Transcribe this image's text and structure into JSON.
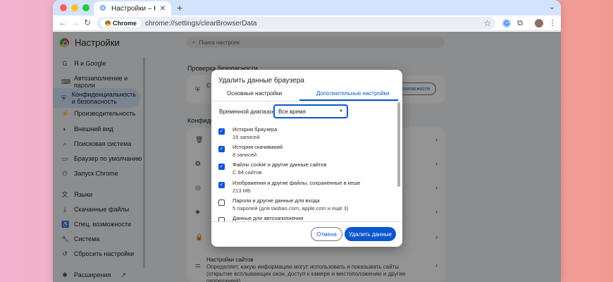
{
  "browser": {
    "tab_title": "Настройки – Конфиденциал",
    "new_tab": "+",
    "chrome_chip": "Chrome",
    "url": "chrome://settings/clearBrowserData"
  },
  "settings": {
    "title": "Настройки",
    "search_placeholder": "Поиск настроек",
    "sidebar": [
      {
        "icon": "G",
        "label": "Я и Google"
      },
      {
        "icon": "⌨",
        "label": "Автозаполнение и пароли"
      },
      {
        "icon": "⛨",
        "label": "Конфиденциальность и безопасность"
      },
      {
        "icon": "⚡",
        "label": "Производительность"
      },
      {
        "icon": "◐",
        "label": "Внешний вид"
      },
      {
        "icon": "⌕",
        "label": "Поисковая система"
      },
      {
        "icon": "▭",
        "label": "Браузер по умолчанию"
      },
      {
        "icon": "⏻",
        "label": "Запуск Chrome"
      },
      {
        "icon": "文",
        "label": "Языки"
      },
      {
        "icon": "⤓",
        "label": "Скачанные файлы"
      },
      {
        "icon": "♿",
        "label": "Спец. возможности"
      },
      {
        "icon": "🔧",
        "label": "Система"
      },
      {
        "icon": "↺",
        "label": "Сбросить настройки"
      },
      {
        "icon": "✱",
        "label": "Расширения"
      }
    ],
    "safety_check_title": "Проверка безопасности",
    "safety_letter": "С",
    "safety_button_tail": "безопасности",
    "privacy_title_fragment": "Конфиде",
    "site_settings_title": "Настройки сайтов",
    "site_settings_desc": "Определяет, какую информацию могут использовать и показывать сайты (открытие всплывающих окон, доступ к камере и местоположению и другие разрешения)"
  },
  "dialog": {
    "title": "Удалить данные браузера",
    "tab_basic": "Основные настройки",
    "tab_advanced": "Дополнительные настройки",
    "range_label": "Временной диапазон",
    "range_value": "Все время",
    "options": [
      {
        "label": "История браузера",
        "sub": "19 записей",
        "checked": true
      },
      {
        "label": "История скачиваний",
        "sub": "8 записей",
        "checked": true
      },
      {
        "label": "Файлы cookie и другие данные сайтов",
        "sub": "С 84 сайтов",
        "checked": true
      },
      {
        "label": "Изображения и другие файлы, сохраненные в кеше",
        "sub": "213 МБ",
        "checked": true
      },
      {
        "label": "Пароли и другие данные для входа",
        "sub": "5 паролей (для taobao.com, apple.com и ещё 3)",
        "checked": false
      },
      {
        "label": "Данные для автозаполнения",
        "sub": "",
        "checked": false
      }
    ],
    "cancel": "Отмена",
    "delete": "Удалить данные"
  }
}
